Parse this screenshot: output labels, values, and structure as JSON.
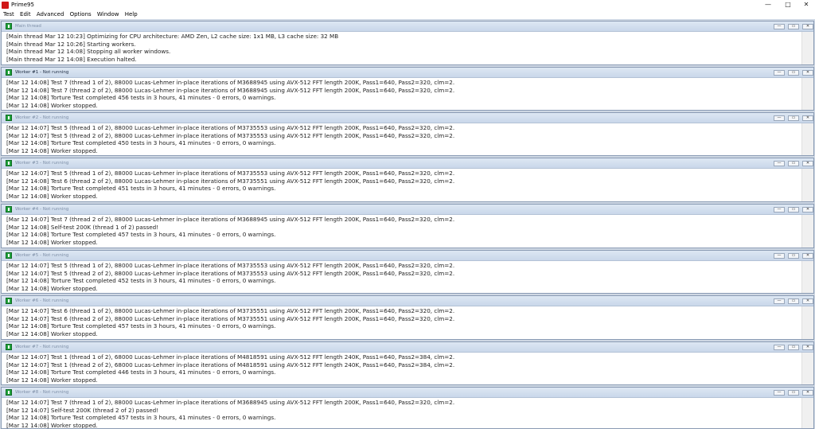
{
  "app": {
    "title": "Prime95",
    "icon": "prime95-app-icon",
    "accent": "#d01818"
  },
  "window_controls": {
    "minimize": "—",
    "maximize": "□",
    "close": "✕"
  },
  "menu": [
    "Test",
    "Edit",
    "Advanced",
    "Options",
    "Window",
    "Help"
  ],
  "child_controls": {
    "minimize": "—",
    "restore": "▭",
    "close": "✕"
  },
  "windows": [
    {
      "title": "Main thread",
      "lines": [
        "[Main thread Mar 12 10:23] Optimizing for CPU architecture: AMD Zen, L2 cache size: 1x1 MB, L3 cache size: 32 MB",
        "[Main thread Mar 12 10:26] Starting workers.",
        "[Main thread Mar 12 14:08] Stopping all worker windows.",
        "[Main thread Mar 12 14:08] Execution halted."
      ]
    },
    {
      "title": "Worker #1 - Not running",
      "lines": [
        "[Mar 12 14:08] Test 7 (thread 1 of 2), 88000 Lucas-Lehmer in-place iterations of M3688945 using AVX-512 FFT length 200K, Pass1=640, Pass2=320, clm=2.",
        "[Mar 12 14:08] Test 7 (thread 2 of 2), 88000 Lucas-Lehmer in-place iterations of M3688945 using AVX-512 FFT length 200K, Pass1=640, Pass2=320, clm=2.",
        "[Mar 12 14:08] Torture Test completed 456 tests in 3 hours, 41 minutes - 0 errors, 0 warnings.",
        "[Mar 12 14:08] Worker stopped."
      ]
    },
    {
      "title": "Worker #2 - Not running",
      "lines": [
        "[Mar 12 14:07] Test 5 (thread 1 of 2), 88000 Lucas-Lehmer in-place iterations of M3735553 using AVX-512 FFT length 200K, Pass1=640, Pass2=320, clm=2.",
        "[Mar 12 14:07] Test 5 (thread 2 of 2), 88000 Lucas-Lehmer in-place iterations of M3735553 using AVX-512 FFT length 200K, Pass1=640, Pass2=320, clm=2.",
        "[Mar 12 14:08] Torture Test completed 450 tests in 3 hours, 41 minutes - 0 errors, 0 warnings.",
        "[Mar 12 14:08] Worker stopped."
      ]
    },
    {
      "title": "Worker #3 - Not running",
      "lines": [
        "[Mar 12 14:07] Test 5 (thread 1 of 2), 88000 Lucas-Lehmer in-place iterations of M3735553 using AVX-512 FFT length 200K, Pass1=640, Pass2=320, clm=2.",
        "[Mar 12 14:08] Test 6 (thread 2 of 2), 88000 Lucas-Lehmer in-place iterations of M3735551 using AVX-512 FFT length 200K, Pass1=640, Pass2=320, clm=2.",
        "[Mar 12 14:08] Torture Test completed 451 tests in 3 hours, 41 minutes - 0 errors, 0 warnings.",
        "[Mar 12 14:08] Worker stopped."
      ]
    },
    {
      "title": "Worker #4 - Not running",
      "lines": [
        "[Mar 12 14:07] Test 7 (thread 2 of 2), 88000 Lucas-Lehmer in-place iterations of M3688945 using AVX-512 FFT length 200K, Pass1=640, Pass2=320, clm=2.",
        "[Mar 12 14:08] Self-test 200K (thread 1 of 2) passed!",
        "[Mar 12 14:08] Torture Test completed 457 tests in 3 hours, 41 minutes - 0 errors, 0 warnings.",
        "[Mar 12 14:08] Worker stopped."
      ]
    },
    {
      "title": "Worker #5 - Not running",
      "lines": [
        "[Mar 12 14:07] Test 5 (thread 1 of 2), 88000 Lucas-Lehmer in-place iterations of M3735553 using AVX-512 FFT length 200K, Pass1=640, Pass2=320, clm=2.",
        "[Mar 12 14:07] Test 5 (thread 2 of 2), 88000 Lucas-Lehmer in-place iterations of M3735553 using AVX-512 FFT length 200K, Pass1=640, Pass2=320, clm=2.",
        "[Mar 12 14:08] Torture Test completed 452 tests in 3 hours, 41 minutes - 0 errors, 0 warnings.",
        "[Mar 12 14:08] Worker stopped."
      ]
    },
    {
      "title": "Worker #6 - Not running",
      "lines": [
        "[Mar 12 14:07] Test 6 (thread 1 of 2), 88000 Lucas-Lehmer in-place iterations of M3735551 using AVX-512 FFT length 200K, Pass1=640, Pass2=320, clm=2.",
        "[Mar 12 14:07] Test 6 (thread 2 of 2), 88000 Lucas-Lehmer in-place iterations of M3735551 using AVX-512 FFT length 200K, Pass1=640, Pass2=320, clm=2.",
        "[Mar 12 14:08] Torture Test completed 457 tests in 3 hours, 41 minutes - 0 errors, 0 warnings.",
        "[Mar 12 14:08] Worker stopped."
      ]
    },
    {
      "title": "Worker #7 - Not running",
      "lines": [
        "[Mar 12 14:07] Test 1 (thread 1 of 2), 68000 Lucas-Lehmer in-place iterations of M4818591 using AVX-512 FFT length 240K, Pass1=640, Pass2=384, clm=2.",
        "[Mar 12 14:07] Test 1 (thread 2 of 2), 68000 Lucas-Lehmer in-place iterations of M4818591 using AVX-512 FFT length 240K, Pass1=640, Pass2=384, clm=2.",
        "[Mar 12 14:08] Torture Test completed 446 tests in 3 hours, 41 minutes - 0 errors, 0 warnings.",
        "[Mar 12 14:08] Worker stopped."
      ]
    },
    {
      "title": "Worker #8 - Not running",
      "lines": [
        "[Mar 12 14:07] Test 7 (thread 1 of 2), 88000 Lucas-Lehmer in-place iterations of M3688945 using AVX-512 FFT length 200K, Pass1=640, Pass2=320, clm=2.",
        "[Mar 12 14:07] Self-test 200K (thread 2 of 2) passed!",
        "[Mar 12 14:08] Torture Test completed 457 tests in 3 hours, 41 minutes - 0 errors, 0 warnings.",
        "[Mar 12 14:08] Worker stopped."
      ]
    }
  ]
}
